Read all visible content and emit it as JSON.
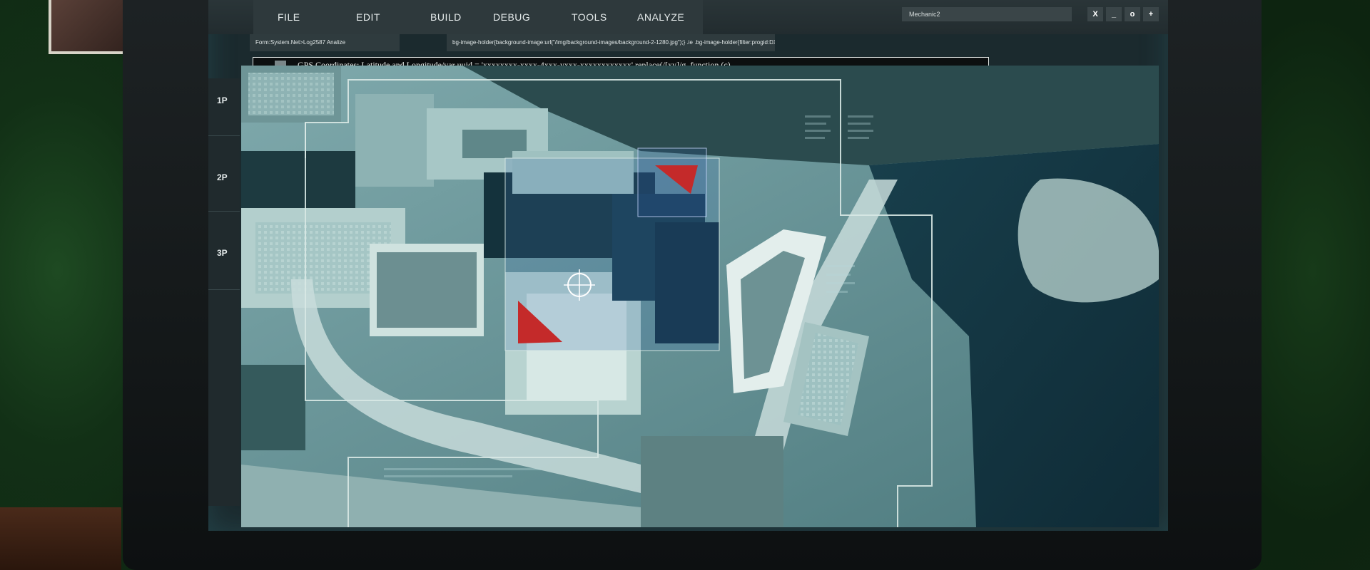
{
  "menu": {
    "items": [
      "FILE",
      "EDIT",
      "BUILD",
      "DEBUG",
      "TOOLS",
      "ANALYZE"
    ]
  },
  "window": {
    "title": "Mechanic2",
    "buttons": [
      "X",
      "_",
      "o",
      "+"
    ]
  },
  "tabs": [
    "Form:System.Net>Log2587 Analize",
    "bg-image-holder{background-image:url(\"/img/background-images/background-2-1280.jpg\");}  .ie .bg-image-holder{filter:progid:DXImageTransform.Microsoft."
  ],
  "code_line": "GPS Coordinates: Latitude and Longitude/var uuid = 'xxxxxxxx-xxxx-4xxx-yxxx-xxxxxxxxxxxx'.replace(/[xy]/g, function (c)",
  "rail": {
    "levels": [
      "1P",
      "2P",
      "3P"
    ]
  },
  "colors": {
    "overlay_line": "#d8e8e4",
    "target_marker": "#c42a2a",
    "map_tint": "#7fb8bc"
  },
  "icons": {
    "target": "crosshair-icon",
    "codebar": "code-file-icon"
  }
}
